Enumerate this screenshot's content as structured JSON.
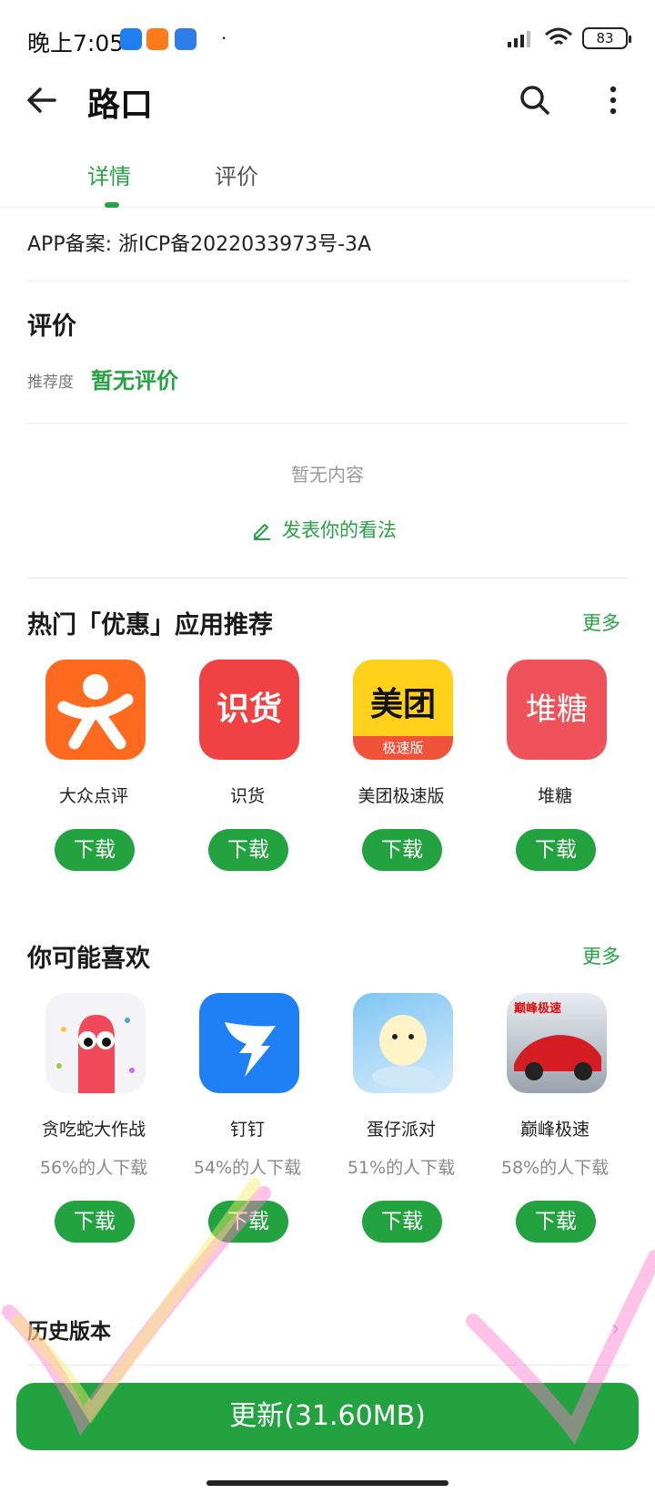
{
  "status_bar": {
    "time": "晚上7:05",
    "battery": "83",
    "dot": "·"
  },
  "header": {
    "title": "路口"
  },
  "tabs": [
    {
      "label": "详情"
    },
    {
      "label": "评价"
    }
  ],
  "icp": "APP备案: 浙ICP备2022033973号-3A",
  "reviews": {
    "title": "评价",
    "recommend_label": "推荐度",
    "recommend_value": "暂无评价",
    "empty": "暂无内容",
    "write_label": "发表你的看法"
  },
  "hot_section": {
    "title": "热门「优惠」应用推荐",
    "more": "更多",
    "apps": [
      {
        "name": "大众点评",
        "button": "下载",
        "icon_text": "",
        "color": "#ff6a1f"
      },
      {
        "name": "识货",
        "button": "下载",
        "icon_text": "识货",
        "color": "#f04242"
      },
      {
        "name": "美团极速版",
        "button": "下载",
        "icon_text": "美团",
        "sub_text": "极速版",
        "color": "#ffd11a"
      },
      {
        "name": "堆糖",
        "button": "下载",
        "icon_text": "堆糖",
        "color": "#f0525a"
      }
    ]
  },
  "like_section": {
    "title": "你可能喜欢",
    "more": "更多",
    "apps": [
      {
        "name": "贪吃蛇大作战",
        "percent": "56%的人下载",
        "button": "下载"
      },
      {
        "name": "钉钉",
        "percent": "54%的人下载",
        "button": "下载"
      },
      {
        "name": "蛋仔派对",
        "percent": "51%的人下载",
        "button": "下载"
      },
      {
        "name": "巅峰极速",
        "percent": "58%的人下载",
        "button": "下载",
        "icon_text": "巅峰极速"
      }
    ]
  },
  "history": {
    "label": "历史版本"
  },
  "update_button": {
    "label": "更新(31.60MB)"
  }
}
